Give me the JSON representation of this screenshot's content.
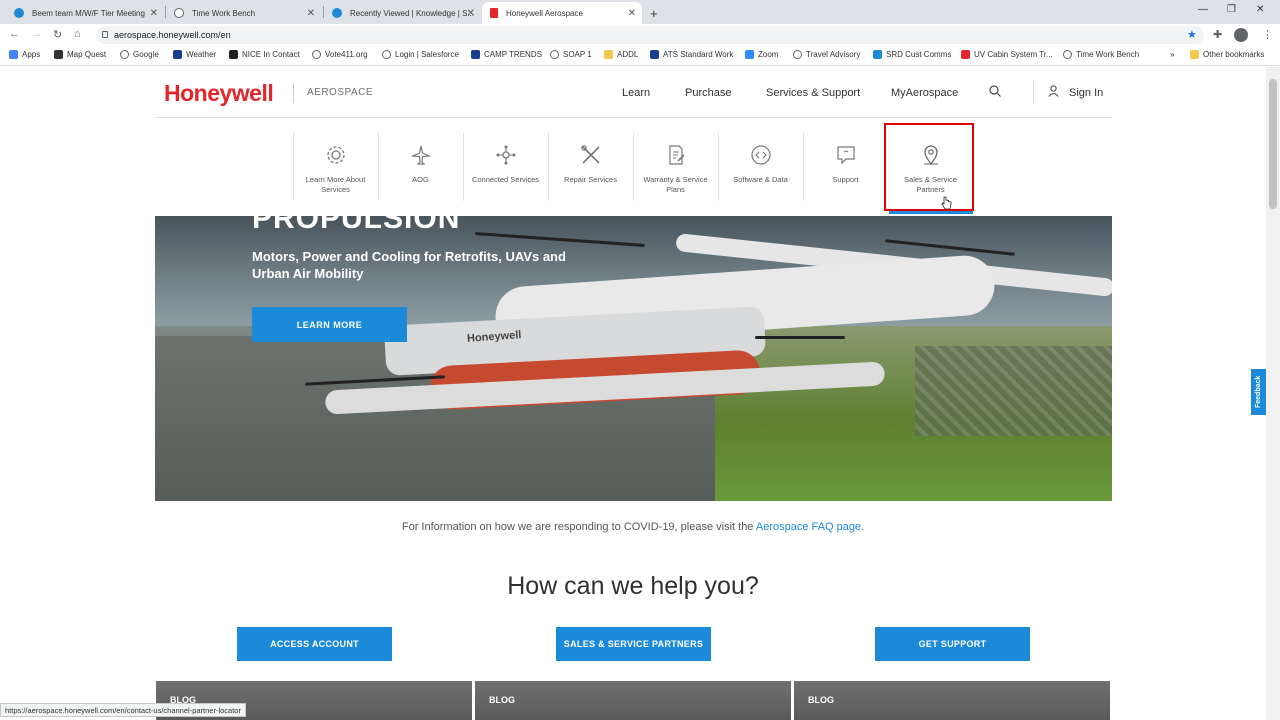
{
  "browser": {
    "tabs": [
      {
        "title": "Beem team M/W/F Tier Meeting",
        "active": false
      },
      {
        "title": "Time Work Bench",
        "active": false
      },
      {
        "title": "Recently Viewed | Knowledge | S...",
        "active": false
      },
      {
        "title": "Honeywell Aerospace",
        "active": true
      }
    ],
    "new_tab_label": "+",
    "url": "aerospace.honeywell.com/en",
    "bookmarks": [
      {
        "label": "Apps"
      },
      {
        "label": "Map Quest"
      },
      {
        "label": "Google"
      },
      {
        "label": "Weather"
      },
      {
        "label": "NICE In Contact"
      },
      {
        "label": "Vote411.org"
      },
      {
        "label": "Login | Salesforce"
      },
      {
        "label": "CAMP TRENDS"
      },
      {
        "label": "SOAP 1"
      },
      {
        "label": "ADDL"
      },
      {
        "label": "ATS Standard Work"
      },
      {
        "label": "Zoom"
      },
      {
        "label": "Travel Advisory"
      },
      {
        "label": "SRD Cust Comms"
      },
      {
        "label": "UV Cabin System Tr..."
      },
      {
        "label": "Time Work Bench"
      }
    ],
    "more_bookmarks": "»",
    "other_bookmarks": "Other bookmarks",
    "status_url": "https://aerospace.honeywell.com/en/contact-us/channel-partner-locator"
  },
  "header": {
    "logo": "Honeywell",
    "logo_sub": "AEROSPACE",
    "nav": [
      "Learn",
      "Purchase",
      "Services & Support",
      "MyAerospace"
    ],
    "sign_in": "Sign In"
  },
  "services": [
    {
      "label": "Learn More About Services",
      "icon": "gear-icon"
    },
    {
      "label": "AOG",
      "icon": "airplane-icon"
    },
    {
      "label": "Connected Services",
      "icon": "network-icon"
    },
    {
      "label": "Repair Services",
      "icon": "tools-icon"
    },
    {
      "label": "Warranty & Service Plans",
      "icon": "document-edit-icon"
    },
    {
      "label": "Software & Data",
      "icon": "code-icon"
    },
    {
      "label": "Support",
      "icon": "chat-icon"
    },
    {
      "label": "Sales & Service Partners",
      "icon": "map-pin-icon"
    }
  ],
  "hero": {
    "title": "PROPULSION",
    "subtitle": "Motors, Power and Cooling for Retrofits, UAVs and Urban Air Mobility",
    "button": "LEARN MORE",
    "drone_brand": "Honeywell"
  },
  "feedback": "Feedback",
  "covid": {
    "text": "For Information on how we are responding to COVID-19, please visit the ",
    "link": "Aerospace FAQ page",
    "end": "."
  },
  "help": {
    "heading": "How can we help you?",
    "buttons": [
      "ACCESS ACCOUNT",
      "SALES & SERVICE PARTNERS",
      "GET SUPPORT"
    ]
  },
  "blogs": [
    "BLOG",
    "BLOG",
    "BLOG"
  ],
  "colors": {
    "brand_red": "#e4252a",
    "accent_blue": "#1b8ad8",
    "highlight_red": "#e00000"
  }
}
